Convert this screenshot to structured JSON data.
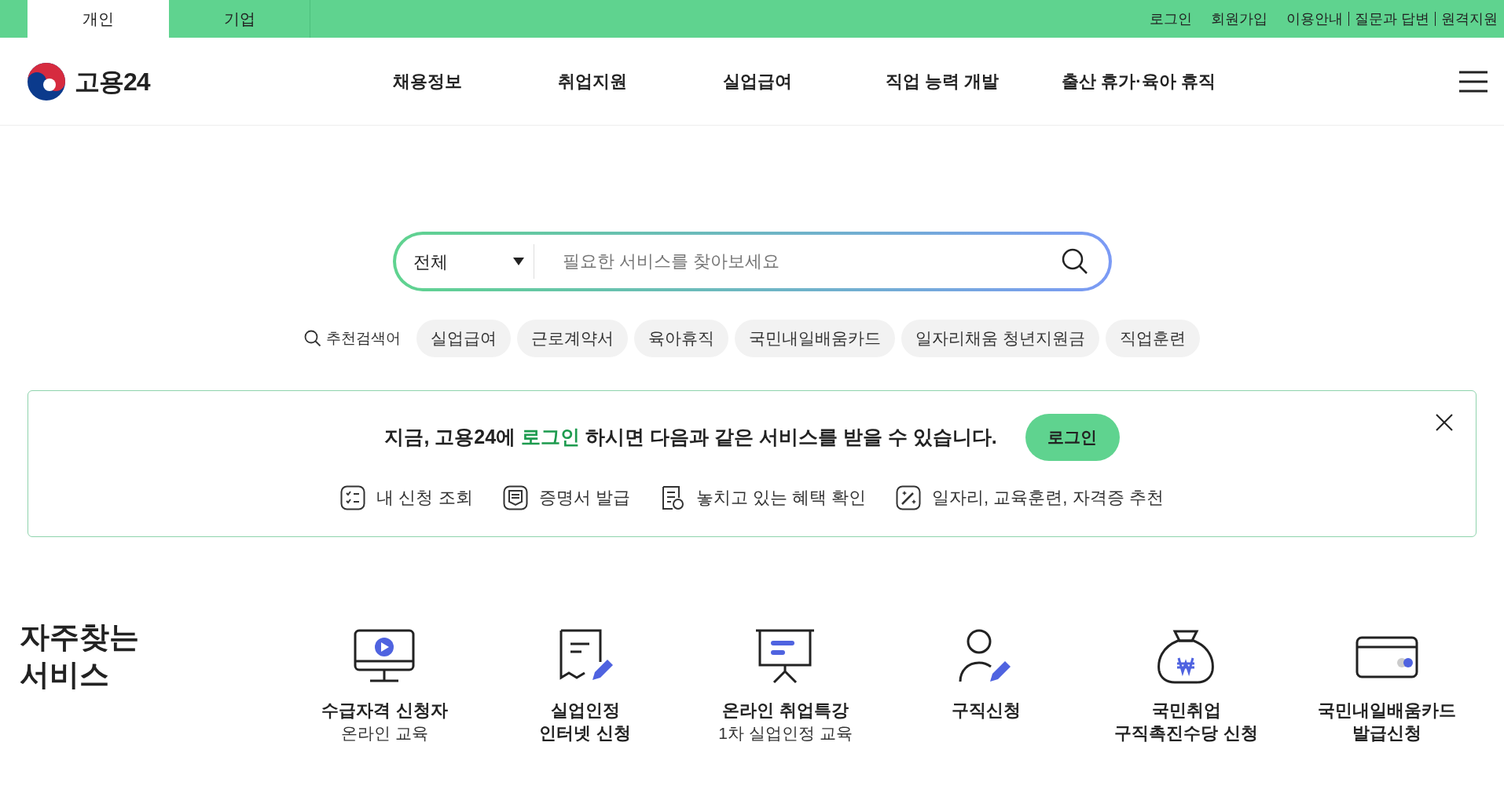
{
  "top_tabs": [
    {
      "label": "개인",
      "selected": true
    },
    {
      "label": "기업",
      "selected": false
    }
  ],
  "top_links": [
    "로그인",
    "회원가입",
    "이용안내",
    "질문과 답변",
    "원격지원"
  ],
  "logo": {
    "text": "고용24"
  },
  "nav": [
    "채용정보",
    "취업지원",
    "실업급여",
    "직업 능력 개발",
    "출산 휴가·육아 휴직"
  ],
  "search": {
    "category": "전체",
    "placeholder": "필요한 서비스를 찾아보세요"
  },
  "recommended": {
    "label": "추천검색어",
    "keywords": [
      "실업급여",
      "근로계약서",
      "육아휴직",
      "국민내일배움카드",
      "일자리채움 청년지원금",
      "직업훈련"
    ]
  },
  "login_banner": {
    "message": [
      {
        "kind": "plain",
        "text": "지금, 고용24에 "
      },
      {
        "kind": "link",
        "text": "로그인"
      },
      {
        "kind": "plain",
        "text": " 하시면 다음과 같은 서비스를 받을 수 있습니다."
      }
    ],
    "button": "로그인",
    "benefits": [
      {
        "kind": "checklist",
        "label": "내 신청 조회"
      },
      {
        "kind": "certificate",
        "label": "증명서 발급"
      },
      {
        "kind": "document",
        "label": "놓치고 있는 혜택 확인"
      },
      {
        "kind": "wand",
        "label": "일자리, 교육훈련, 자격증 추천"
      }
    ]
  },
  "frequent_services": {
    "title": "자주찾는 서비스",
    "items": [
      {
        "kind": "monitor",
        "title": [
          "수급자격 신청자"
        ],
        "subtitle": "온라인 교육"
      },
      {
        "kind": "document",
        "title": [
          "실업인정",
          "인터넷 신청"
        ]
      },
      {
        "kind": "board",
        "title": [
          "온라인 취업특강"
        ],
        "subtitle": "1차 실업인정 교육"
      },
      {
        "kind": "person",
        "title": [
          "구직신청"
        ]
      },
      {
        "kind": "moneybag",
        "title": [
          "국민취업",
          "구직촉진수당 신청"
        ]
      },
      {
        "kind": "card",
        "title": [
          "국민내일배움카드",
          "발급신청"
        ]
      }
    ]
  }
}
